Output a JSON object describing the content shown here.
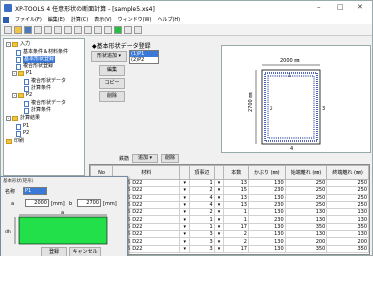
{
  "app_title": "XP-TOOLS 4 任意形状の断面計算 - [sample5.xs4]",
  "window_controls": {
    "min": "–",
    "max": "□",
    "close": "✕"
  },
  "menu": [
    "ファイル(F)",
    "編集(E)",
    "計算(C)",
    "表示(V)",
    "ウィンドウ(W)",
    "ヘルプ(H)"
  ],
  "tree": [
    {
      "label": "入力",
      "kind": "folder",
      "expand": "-"
    },
    {
      "label": "基本条件＆材料条件",
      "kind": "doc"
    },
    {
      "label": "基本形状登録",
      "kind": "doc",
      "selected": true
    },
    {
      "label": "複合形状登録",
      "kind": "doc"
    },
    {
      "label": "P1",
      "kind": "folder",
      "expand": "-"
    },
    {
      "label": "複合形状データ",
      "kind": "doc"
    },
    {
      "label": "計算条件",
      "kind": "doc"
    },
    {
      "label": "P2",
      "kind": "folder",
      "expand": "-"
    },
    {
      "label": "複合形状データ",
      "kind": "doc"
    },
    {
      "label": "計算条件",
      "kind": "doc"
    },
    {
      "label": "計算結果",
      "kind": "folder",
      "expand": "-"
    },
    {
      "label": "P1",
      "kind": "doc"
    },
    {
      "label": "P2",
      "kind": "doc"
    },
    {
      "label": "印刷",
      "kind": "folder"
    }
  ],
  "panel": {
    "heading": "◆基本形状データ登録",
    "shape_label": "形状追加",
    "add_dropdown": "",
    "edit_button": "編集",
    "copy_button": "コピー",
    "delete_button": "削除",
    "shape_list": [
      "(1)P1",
      "(2)P2"
    ],
    "selected_shape": "(1)P1"
  },
  "preview": {
    "width_label": "2000 ㎜",
    "height_label": "2700 ㎜",
    "marker_right": "3",
    "marker_bottom": "4",
    "marker_left": "2",
    "marker_top": "1"
  },
  "grid_controls": {
    "rebar": "鉄筋",
    "add": "追加",
    "delete": "削除"
  },
  "grid": {
    "columns": [
      "No",
      "材料",
      "",
      "頂事辺",
      "",
      "本数",
      "かぶり\n(㎜)",
      "始端離れ\n(㎜)",
      "終端離れ\n(㎜)"
    ],
    "rows": [
      [
        "1",
        "SD345 D22",
        "▾",
        "1",
        "▾",
        "13",
        "130",
        "250",
        "250"
      ],
      [
        "2",
        "SD345 D22",
        "▾",
        "2",
        "▾",
        "15",
        "230",
        "250",
        "250"
      ],
      [
        "3",
        "SD345 D22",
        "▾",
        "4",
        "▾",
        "13",
        "130",
        "250",
        "250"
      ],
      [
        "4",
        "SD345 D22",
        "▾",
        "4",
        "▾",
        "13",
        "230",
        "250",
        "250"
      ],
      [
        "5",
        "SD345 D22",
        "▾",
        "2",
        "▾",
        "1",
        "130",
        "130",
        "130"
      ],
      [
        "6",
        "SD345 D22",
        "▾",
        "1",
        "▾",
        "1",
        "230",
        "130",
        "130"
      ],
      [
        "7",
        "SD345 D22",
        "▾",
        "1",
        "▾",
        "17",
        "130",
        "350",
        "350"
      ],
      [
        "8",
        "SD345 D22",
        "▾",
        "3",
        "▾",
        "2",
        "130",
        "130",
        "130"
      ],
      [
        "9",
        "SD345 D22",
        "▾",
        "3",
        "▾",
        "2",
        "130",
        "200",
        "200"
      ],
      [
        "10",
        "SD345 D22",
        "▾",
        "3",
        "▾",
        "17",
        "130",
        "350",
        "350"
      ]
    ]
  },
  "dialog": {
    "title": "基本形状(矩形)",
    "name_label": "名称",
    "name_value": "P1",
    "a_label": "a",
    "a_value": "2000",
    "a_unit": "[mm]",
    "b_label": "b",
    "b_value": "2700",
    "b_unit": "[mm]",
    "dim_a": "a",
    "dim_b": "dh",
    "ok_button": "登録",
    "cancel_button": "キャンセル"
  },
  "colors": {
    "shape_fill": "#22e04a",
    "selection": "#3a79d8"
  }
}
